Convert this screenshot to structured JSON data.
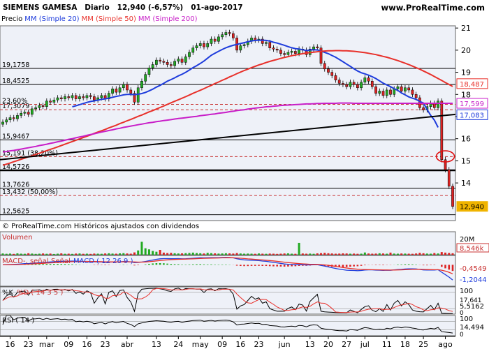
{
  "header": {
    "ticker": "SIEMENS GAMESA",
    "period": "Diario",
    "quote": "12,940 (-6,57%)",
    "date": "01-ago-2017",
    "brand": "www.ProRealTime.com"
  },
  "legend": {
    "price": "Precio",
    "ma20": "MM (Simple 20)",
    "ma50": "MM (Simple 50)",
    "ma200": "MM (Simple 200)"
  },
  "colors": {
    "up": "#22aa22",
    "down": "#dd2222",
    "ma20": "#1e3cdc",
    "ma50": "#e8302a",
    "ma200": "#c81ec8",
    "panel_bg": "#eef1f8"
  },
  "chart_data": {
    "type": "candlestick",
    "price_ylim": [
      12.3,
      21.1
    ],
    "y_ticks": [
      14,
      15,
      16,
      17,
      18,
      19,
      20,
      21
    ],
    "x_tick_labels": [
      "16",
      "23",
      "mar",
      "09",
      "16",
      "23",
      "abr",
      "13",
      "24",
      "may",
      "09",
      "16",
      "23",
      "jun",
      "13",
      "20",
      "27",
      "jul",
      "11",
      "18",
      "25",
      "ago"
    ],
    "x_tick_index": [
      2,
      7,
      12,
      18,
      23,
      28,
      34,
      42,
      48,
      54,
      60,
      65,
      70,
      77,
      84,
      89,
      94,
      99,
      105,
      110,
      115,
      121
    ],
    "close": [
      16.75,
      16.85,
      16.95,
      16.9,
      17.05,
      17.15,
      17.2,
      17.1,
      17.35,
      17.4,
      17.5,
      17.45,
      17.7,
      17.65,
      17.75,
      17.85,
      17.8,
      17.9,
      17.85,
      17.95,
      17.8,
      17.9,
      17.85,
      17.95,
      17.9,
      17.75,
      17.85,
      17.95,
      17.8,
      18.05,
      18.25,
      18.1,
      18.3,
      18.45,
      18.2,
      18.05,
      17.65,
      18.3,
      18.6,
      18.9,
      19.2,
      19.35,
      19.55,
      19.5,
      19.45,
      19.35,
      19.3,
      19.5,
      19.6,
      19.45,
      19.7,
      19.9,
      20.1,
      20.2,
      20.3,
      20.15,
      20.3,
      20.5,
      20.4,
      20.6,
      20.7,
      20.8,
      20.75,
      20.55,
      20.0,
      20.2,
      20.25,
      20.4,
      20.55,
      20.45,
      20.5,
      20.3,
      20.35,
      20.1,
      20.05,
      20.0,
      19.85,
      19.8,
      19.9,
      19.95,
      19.85,
      20.05,
      20.0,
      19.8,
      20.05,
      20.15,
      20.1,
      19.4,
      19.15,
      19.0,
      18.85,
      18.65,
      18.5,
      18.45,
      18.35,
      18.55,
      18.45,
      18.3,
      18.55,
      18.75,
      18.6,
      18.35,
      18.05,
      18.15,
      17.95,
      18.2,
      18.0,
      18.25,
      18.35,
      18.15,
      18.3,
      18.2,
      18.0,
      17.85,
      17.4,
      17.3,
      17.45,
      17.6,
      17.4,
      17.7,
      15.05,
      14.6,
      13.85,
      12.94
    ],
    "series": [
      {
        "name": "MM (Simple 20)",
        "values": [
          null,
          null,
          null,
          null,
          null,
          null,
          null,
          null,
          null,
          null,
          null,
          null,
          null,
          null,
          null,
          null,
          null,
          null,
          null,
          17.44,
          17.49,
          17.54,
          17.59,
          17.64,
          17.68,
          17.71,
          17.74,
          17.78,
          17.8,
          17.83,
          17.87,
          17.91,
          17.94,
          17.98,
          18.0,
          18.0,
          17.99,
          18.01,
          18.04,
          18.09,
          18.16,
          18.24,
          18.33,
          18.41,
          18.5,
          18.6,
          18.67,
          18.75,
          18.84,
          18.91,
          19.0,
          19.1,
          19.21,
          19.3,
          19.4,
          19.51,
          19.64,
          19.77,
          19.86,
          19.95,
          20.03,
          20.11,
          20.17,
          20.22,
          20.26,
          20.3,
          20.34,
          20.38,
          20.42,
          20.44,
          20.45,
          20.45,
          20.44,
          20.41,
          20.36,
          20.32,
          20.27,
          20.22,
          20.16,
          20.11,
          20.07,
          20.05,
          20.02,
          19.98,
          20.01,
          20.02,
          20.01,
          19.96,
          19.9,
          19.84,
          19.76,
          19.68,
          19.58,
          19.48,
          19.37,
          19.27,
          19.16,
          19.06,
          18.98,
          18.93,
          18.87,
          18.8,
          18.72,
          18.61,
          18.51,
          18.43,
          18.35,
          18.26,
          18.18,
          18.07,
          17.98,
          17.89,
          17.83,
          17.78,
          17.68,
          17.61,
          17.32,
          17.05,
          16.84,
          16.51
        ]
      },
      {
        "name": "MM (Simple 50)",
        "values": [
          14.8,
          14.85,
          14.9,
          14.96,
          15.01,
          15.07,
          15.12,
          15.18,
          15.23,
          15.29,
          15.34,
          15.4,
          15.46,
          15.52,
          15.57,
          15.63,
          15.69,
          15.75,
          15.81,
          15.87,
          15.93,
          15.99,
          16.05,
          16.11,
          16.17,
          16.24,
          16.3,
          16.36,
          16.42,
          16.49,
          16.55,
          16.61,
          16.68,
          16.74,
          16.81,
          16.87,
          16.94,
          17.01,
          17.07,
          17.14,
          17.21,
          17.27,
          17.34,
          17.41,
          17.48,
          17.55,
          17.62,
          17.69,
          17.76,
          17.83,
          17.9,
          17.97,
          18.05,
          18.12,
          18.19,
          18.26,
          18.34,
          18.41,
          18.49,
          18.56,
          18.64,
          18.71,
          18.79,
          18.86,
          18.94,
          19.01,
          19.08,
          19.14,
          19.21,
          19.27,
          19.33,
          19.38,
          19.44,
          19.49,
          19.54,
          19.58,
          19.63,
          19.67,
          19.71,
          19.75,
          19.78,
          19.81,
          19.84,
          19.87,
          19.89,
          19.91,
          19.93,
          19.95,
          19.96,
          19.97,
          19.97,
          19.98,
          19.98,
          19.97,
          19.97,
          19.96,
          19.95,
          19.93,
          19.91,
          19.89,
          19.86,
          19.83,
          19.8,
          19.76,
          19.72,
          19.68,
          19.63,
          19.58,
          19.53,
          19.47,
          19.41,
          19.35,
          19.28,
          19.21,
          19.14,
          19.06,
          18.98,
          18.9,
          18.81,
          18.72,
          18.63,
          18.54,
          18.45,
          18.36
        ]
      },
      {
        "name": "MM (Simple 200)",
        "values": [
          15.4,
          15.42,
          15.45,
          15.47,
          15.5,
          15.53,
          15.56,
          15.59,
          15.62,
          15.65,
          15.69,
          15.72,
          15.75,
          15.79,
          15.82,
          15.86,
          15.89,
          15.93,
          15.97,
          16.0,
          16.04,
          16.08,
          16.11,
          16.15,
          16.19,
          16.22,
          16.26,
          16.3,
          16.33,
          16.37,
          16.4,
          16.44,
          16.47,
          16.51,
          16.54,
          16.57,
          16.6,
          16.63,
          16.66,
          16.69,
          16.72,
          16.74,
          16.77,
          16.79,
          16.82,
          16.84,
          16.86,
          16.89,
          16.91,
          16.93,
          16.95,
          16.97,
          16.99,
          17.01,
          17.04,
          17.06,
          17.08,
          17.1,
          17.12,
          17.15,
          17.17,
          17.19,
          17.22,
          17.24,
          17.27,
          17.29,
          17.31,
          17.34,
          17.36,
          17.38,
          17.4,
          17.42,
          17.44,
          17.45,
          17.47,
          17.48,
          17.5,
          17.51,
          17.52,
          17.53,
          17.54,
          17.55,
          17.56,
          17.57,
          17.57,
          17.58,
          17.59,
          17.59,
          17.6,
          17.6,
          17.6,
          17.6,
          17.61,
          17.61,
          17.61,
          17.61,
          17.6,
          17.6,
          17.6,
          17.6,
          17.6,
          17.6,
          17.6,
          17.6,
          17.6,
          17.6,
          17.6,
          17.6,
          17.6,
          17.6,
          17.6,
          17.6,
          17.6,
          17.6,
          17.6,
          17.6,
          17.6,
          17.6,
          17.6,
          17.6,
          17.6,
          17.6,
          17.6,
          17.6
        ]
      }
    ],
    "support_trendline": [
      [
        0,
        15.05
      ],
      [
        124,
        17.1
      ]
    ],
    "h_lines": [
      {
        "label": "19,1758",
        "y": 19.1758,
        "style": "solid"
      },
      {
        "label": "18,4525",
        "y": 18.4525,
        "style": "solid"
      },
      {
        "label": "17,3079",
        "y": 17.3079,
        "style": "dashed"
      },
      {
        "label": "23,60%",
        "y": 17.55,
        "style": "dashed"
      },
      {
        "label": "15,9467",
        "y": 15.9467,
        "style": "solid"
      },
      {
        "label": "15,191 (38,20%)",
        "y": 15.191,
        "style": "dashed"
      },
      {
        "label": "14,5726",
        "y": 14.5726,
        "style": "bold"
      },
      {
        "label": "13,7626",
        "y": 13.7626,
        "style": "solid"
      },
      {
        "label": "13,432 (50,00%)",
        "y": 13.432,
        "style": "dashed"
      },
      {
        "label": "12,5625",
        "y": 12.5625,
        "style": "solid"
      }
    ],
    "right_badges": [
      {
        "label": "18,487",
        "y": 18.487,
        "color": "#e8302a"
      },
      {
        "label": "17,599",
        "y": 17.599,
        "color": "#c81ec8"
      },
      {
        "label": "17,083",
        "y": 17.083,
        "color": "#1e3cdc"
      },
      {
        "label": "12,940",
        "y": 12.94,
        "color": "#f0b400"
      }
    ],
    "highlight_circle": {
      "index": 121,
      "y": 15.2
    },
    "footnote": "© ProRealTime.com  Históricos ajustados con dividendos",
    "volume": {
      "label": "Volumen",
      "ylabel_top": "20M",
      "last_value": "8,546k",
      "values": [
        1.2,
        0.9,
        1.1,
        0.8,
        1.3,
        1.0,
        0.9,
        1.4,
        1.1,
        0.8,
        1.0,
        1.2,
        0.9,
        1.1,
        0.7,
        1.0,
        1.3,
        0.9,
        1.0,
        0.8,
        1.1,
        1.2,
        0.9,
        1.0,
        0.8,
        1.1,
        1.0,
        0.9,
        1.2,
        1.4,
        1.1,
        1.0,
        1.3,
        1.5,
        1.2,
        1.0,
        2.2,
        4.0,
        12.0,
        6.0,
        5.0,
        3.5,
        2.8,
        4.5,
        2.0,
        1.6,
        1.8,
        1.4,
        1.2,
        1.3,
        1.5,
        1.7,
        2.0,
        1.6,
        1.4,
        1.2,
        1.8,
        1.5,
        1.3,
        1.1,
        1.2,
        1.4,
        1.3,
        1.1,
        1.6,
        1.2,
        1.0,
        1.1,
        1.0,
        0.9,
        1.2,
        1.0,
        0.9,
        1.1,
        1.0,
        0.8,
        1.0,
        1.2,
        1.3,
        1.0,
        0.9,
        11.0,
        1.2,
        1.0,
        1.1,
        0.9,
        1.3,
        1.5,
        1.8,
        1.4,
        1.2,
        1.0,
        1.1,
        1.3,
        1.2,
        1.0,
        1.1,
        0.9,
        1.0,
        2.1,
        1.2,
        1.0,
        1.1,
        1.4,
        1.2,
        1.0,
        2.0,
        1.1,
        1.0,
        1.2,
        1.1,
        1.0,
        0.9,
        1.2,
        1.8,
        1.4,
        1.1,
        1.0,
        1.6,
        1.2,
        2.5,
        2.0,
        1.7,
        1.4
      ],
      "ylim": [
        0,
        20
      ]
    },
    "macd": {
      "label_a": "MACD-, señal",
      "label_b": "Señal",
      "label_c": "MACD ( 12 26 9 )",
      "value_1": "-0,4549",
      "value_2": "-1,2044",
      "ylim": [
        -1.6,
        0.7
      ]
    },
    "stoch": {
      "label_k": "%K",
      "label_d": "%D ( 14 3 5 )",
      "tick_100": "100",
      "tick_0": "0",
      "value_1": "17,641",
      "value_2": "5,5162",
      "ylim": [
        0,
        100
      ]
    },
    "rsi": {
      "label": "RSI ( 14 )",
      "tick_100": "100",
      "tick_0": "0",
      "value": "14,494",
      "ylim": [
        0,
        100
      ]
    }
  }
}
